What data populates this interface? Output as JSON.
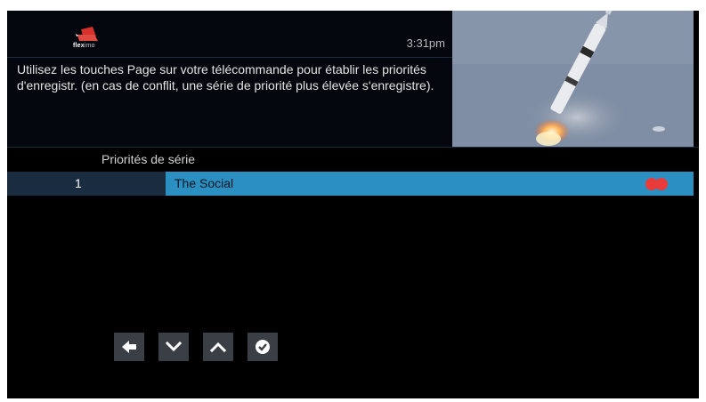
{
  "app": {
    "logo_prefix": "flex",
    "logo_suffix": "imo",
    "clock": "3:31pm"
  },
  "instructions": "Utilisez les touches Page sur votre télécommande pour établir les priorités d'enregistr. (en cas de conflit, une série de priorité plus élevée s'enregistre).",
  "list": {
    "column_header": "Priorités de série",
    "rows": [
      {
        "priority": "1",
        "title": "The Social",
        "status_icon": "record-series-icon"
      }
    ]
  },
  "nav_buttons": [
    {
      "name": "back-button",
      "icon": "arrow-left-icon"
    },
    {
      "name": "move-down-button",
      "icon": "chevron-down-icon"
    },
    {
      "name": "move-up-button",
      "icon": "chevron-up-icon"
    },
    {
      "name": "confirm-button",
      "icon": "checkmark-circle-icon"
    }
  ],
  "colors": {
    "background": "#000000",
    "header_background": "#03070d",
    "selected_row": "#2c8fc1",
    "priority_cell": "#1a2c40",
    "record_icon": "#ea3b3b",
    "nav_button": "#3a3f45",
    "logo_red": "#d8312c"
  }
}
